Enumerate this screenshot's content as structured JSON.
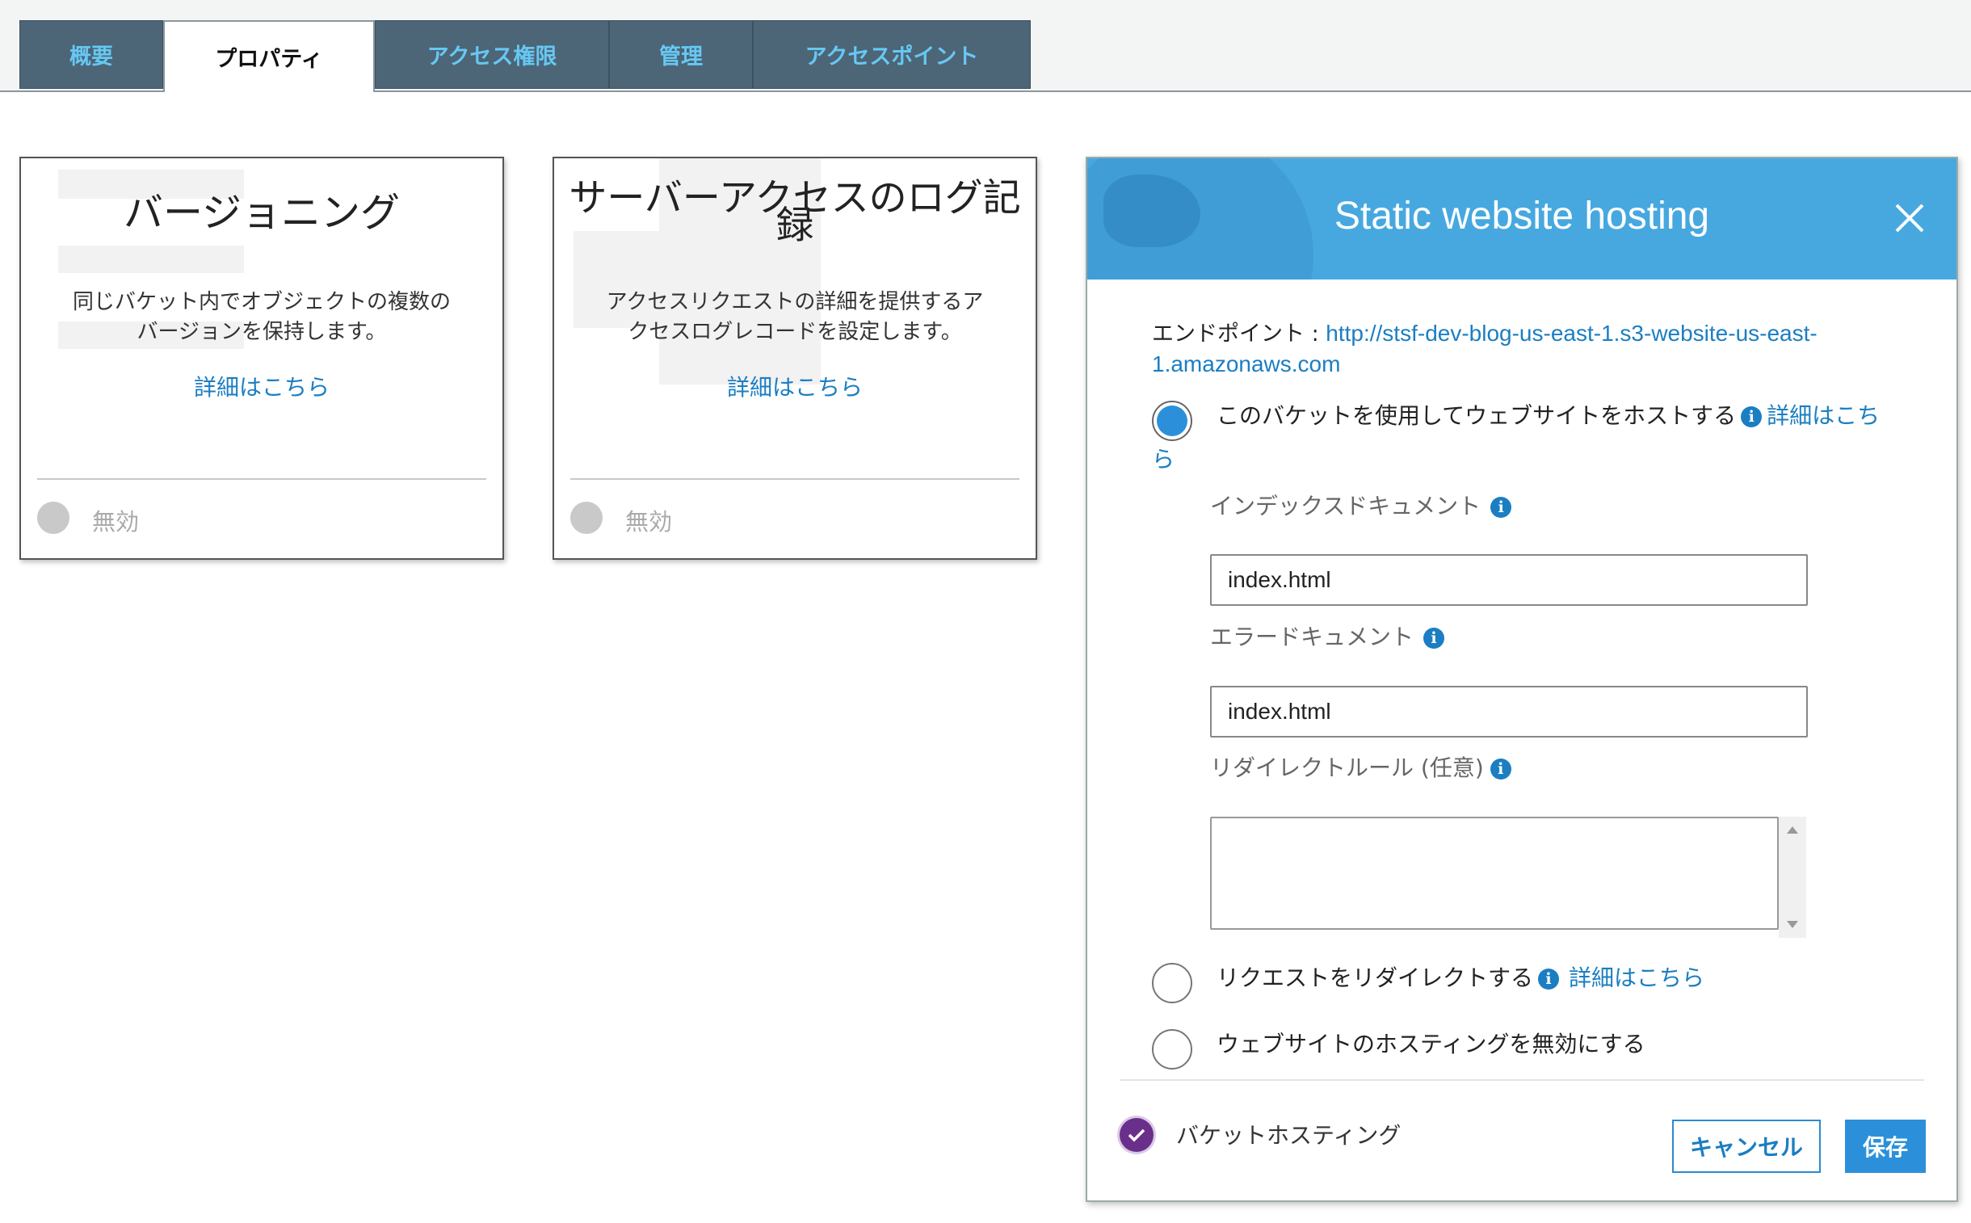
{
  "tabs": [
    {
      "label": "概要"
    },
    {
      "label": "プロパティ"
    },
    {
      "label": "アクセス権限"
    },
    {
      "label": "管理"
    },
    {
      "label": "アクセスポイント"
    }
  ],
  "cards": [
    {
      "title": "バージョニング",
      "desc_line1": "同じバケット内でオブジェクトの複数の",
      "desc_line2": "バージョンを保持します。",
      "link": "詳細はこちら",
      "status": "無効"
    },
    {
      "title_line1": "サーバーアクセスのログ記",
      "title_line2": "録",
      "desc_line1": "アクセスリクエストの詳細を提供するア",
      "desc_line2": "クセスログレコードを設定します。",
      "link": "詳細はこちら",
      "status": "無効"
    }
  ],
  "modal": {
    "title": "Static website hosting",
    "endpoint_label": "エンドポイント : ",
    "endpoint_url_line1": "http://stsf-dev-blog-us-east-1.s3-website-us-east-",
    "endpoint_url_line2": "1.amazonaws.com",
    "option_host": "このバケットを使用してウェブサイトをホストする",
    "option_host_link_part1": "詳細はこち",
    "option_host_link_part2": "ら",
    "index_doc_label": "インデックスドキュメント",
    "index_doc_value": "index.html",
    "error_doc_label": "エラードキュメント",
    "error_doc_value": "index.html",
    "redirect_rules_label": "リダイレクトルール (任意)",
    "redirect_rules_value": "",
    "option_redirect": "リクエストをリダイレクトする",
    "option_redirect_link": "詳細はこちら",
    "option_disable": "ウェブサイトのホスティングを無効にする",
    "footer_label": "バケットホスティング",
    "cancel_label": "キャンセル",
    "save_label": "保存",
    "info_glyph": "i"
  },
  "colors": {
    "tab_bg": "#4c6577",
    "tab_text": "#66c8f2",
    "header_blue": "#47a8e0",
    "link_blue": "#1b7ec2",
    "radio_selected": "#2b90d9",
    "check_purple": "#6a2f8a"
  },
  "icons": {
    "close": "close-icon",
    "info": "info-icon",
    "check": "check-circle-icon",
    "globe": "globe-illustration"
  }
}
